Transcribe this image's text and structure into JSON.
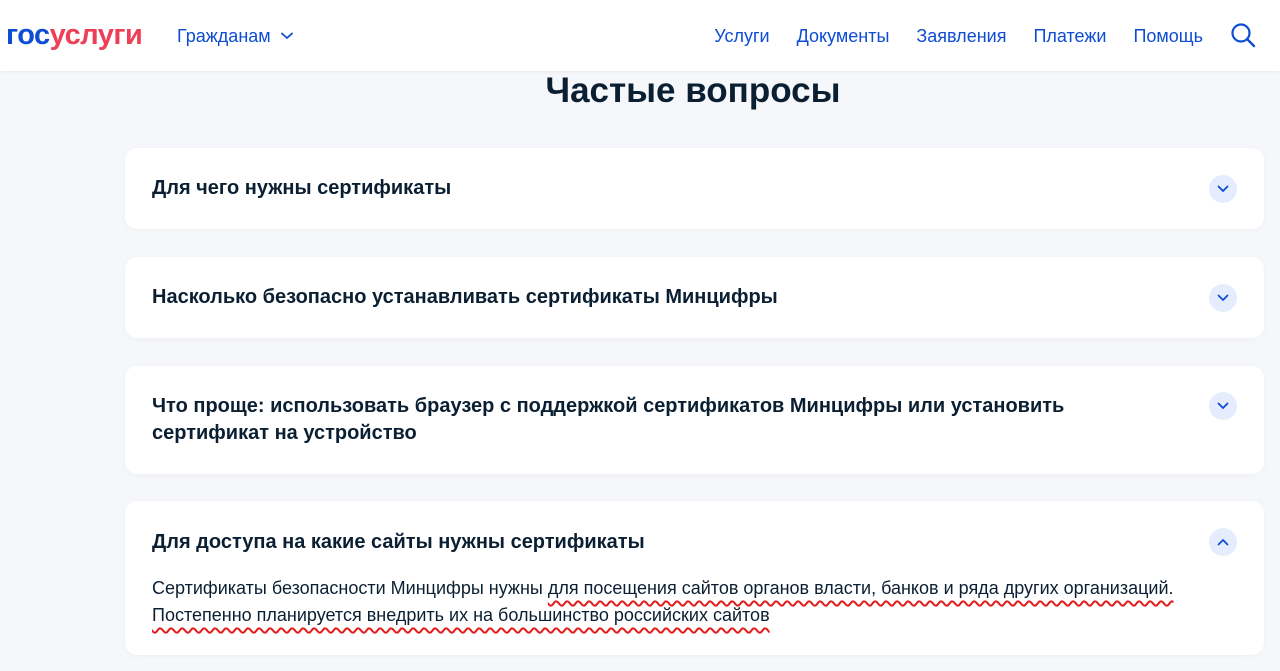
{
  "header": {
    "logo_part1": "гос",
    "logo_part2": "услуги",
    "citizens_label": "Гражданам",
    "nav": [
      "Услуги",
      "Документы",
      "Заявления",
      "Платежи",
      "Помощь"
    ],
    "icons": {
      "search": "search-icon",
      "dropdown": "chevron-down-icon"
    }
  },
  "main": {
    "title": "Частые вопросы",
    "faq": [
      {
        "question": "Для чего нужны сертификаты",
        "expanded": false
      },
      {
        "question": "Насколько безопасно устанавливать сертификаты Минцифры",
        "expanded": false
      },
      {
        "question": "Что проще: использовать браузер с поддержкой сертификатов Минцифры или установить сертификат на устройство",
        "expanded": false
      },
      {
        "question": "Для доступа на какие сайты нужны сертификаты",
        "expanded": true,
        "answer_part1": "Сертификаты безопасности Минцифры нужны ",
        "answer_highlight": "для посещения сайтов органов власти, банков и ряда других организаций. Постепенно планируется внедрить их на большинство российских сайтов"
      }
    ]
  },
  "colors": {
    "brand_blue": "#0d4cd3",
    "brand_red": "#ee3f58",
    "chevron_bg": "#e4ecfd",
    "annotation_red": "#e21d1d",
    "page_bg": "#f5f7fa"
  }
}
